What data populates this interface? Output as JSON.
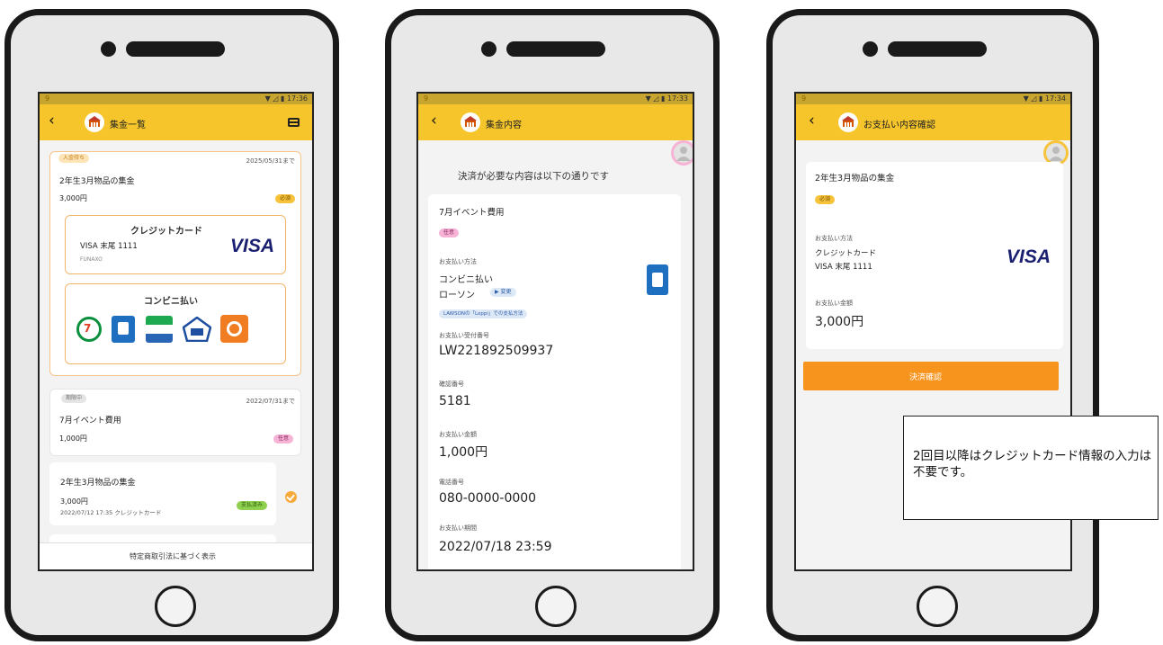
{
  "phone1": {
    "status": {
      "left": "9",
      "right": "▼ ◿ ▮ 17:36"
    },
    "header": {
      "back": "‹",
      "title": "集金一覧",
      "right_icon": "card-icon"
    },
    "item1": {
      "status_badge": "入金待ち",
      "deadline": "2025/05/31まで",
      "title": "2年生3月物品の集金",
      "amount": "3,000円",
      "tag": "必須",
      "credit_title": "クレジットカード",
      "card_info": "VISA 末尾 1111",
      "card_holder": "FUNAXO",
      "brand": "VISA",
      "conv_title": "コンビニ払い",
      "stores": [
        "seven-eleven-icon",
        "lawson-icon",
        "familymart-icon",
        "ministop-icon",
        "seicomart-icon"
      ]
    },
    "item2": {
      "status_badge": "期限中",
      "deadline": "2022/07/31まで",
      "title": "7月イベント費用",
      "amount": "1,000円",
      "tag": "任意"
    },
    "item3": {
      "title": "2年生3月物品の集金",
      "amount": "3,000円",
      "detail": "2022/07/12 17:35 クレジットカード",
      "tag": "支払済み"
    },
    "footer": "特定商取引法に基づく表示"
  },
  "phone2": {
    "status": {
      "left": "9",
      "right": "▼ ◿ ▮ 17:33"
    },
    "header": {
      "back": "‹",
      "title": "集金内容"
    },
    "notice": "決済が必要な内容は以下の通りです",
    "item_title": "7月イベント費用",
    "tag": "任意",
    "payment_method_label": "お支払い方法",
    "payment_method": "コンビニ払い",
    "store": "ローソン",
    "change_button": "▶ 変更",
    "loppi_badge": "LAWSONの「Loppi」での支払方法",
    "receipt_label": "お支払い受付番号",
    "receipt_number": "LW221892509937",
    "confirm_label": "確認番号",
    "confirm_number": "5181",
    "amount_label": "お支払い金額",
    "amount": "1,000円",
    "phone_label": "電話番号",
    "phone": "080-0000-0000",
    "deadline_label": "お支払い期間",
    "deadline": "2022/07/18 23:59"
  },
  "phone3": {
    "status": {
      "left": "9",
      "right": "▼ ◿ ▮ 17:34"
    },
    "header": {
      "back": "‹",
      "title": "お支払い内容確認"
    },
    "item_title": "2年生3月物品の集金",
    "tag": "必須",
    "payment_method_label": "お支払い方法",
    "payment_method": "クレジットカード",
    "card_info": "VISA 末尾 1111",
    "brand": "VISA",
    "amount_label": "お支払い金額",
    "amount": "3,000円",
    "confirm_button": "決済確認"
  },
  "callout": "2回目以降はクレジットカード情報の入力は不要です。",
  "colors": {
    "header": "#f5c52b",
    "accent": "#f7941d",
    "visa": "#1a1f71",
    "pink": "#f6b3d6",
    "orange_button": "#f7941d"
  }
}
